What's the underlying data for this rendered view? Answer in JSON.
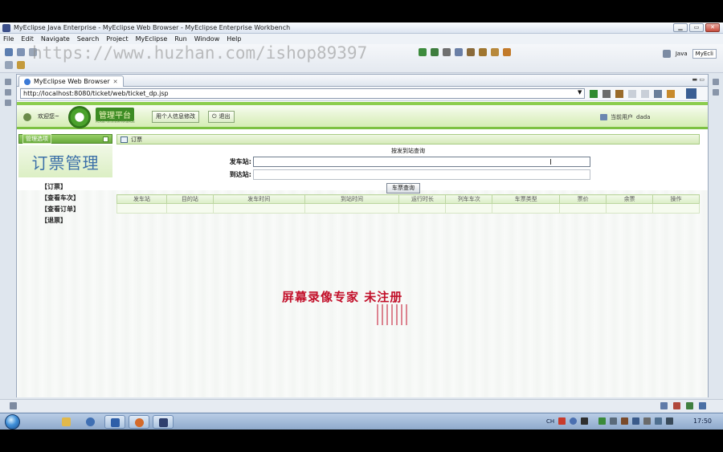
{
  "window": {
    "title": "MyEclipse Java Enterprise - MyEclipse Web Browser - MyEclipse Enterprise Workbench",
    "minimize": "▁",
    "maximize": "▭",
    "close": "✕"
  },
  "menubar": [
    "File",
    "Edit",
    "Navigate",
    "Search",
    "Project",
    "MyEclipse",
    "Run",
    "Window",
    "Help"
  ],
  "toolbar": {
    "watermark": "https://www.huzhan.com/ishop89397",
    "perspectives": [
      "Java",
      "MyEcli"
    ]
  },
  "editor": {
    "tab_label": "MyEclipse Web Browser",
    "tab_close": "✕",
    "controls": "▬ ▭",
    "url": "http://localhost:8080/ticket/web/ticket_dp.jsp"
  },
  "site_header": {
    "welcome": "欢迎您~",
    "logo_title": "管理平台",
    "logo_sub": "PLANT·SYSTEM·MANAGE",
    "edit_profile_button": "用个人信息修改",
    "logout_button": "退出",
    "current_user_label": "当前用户",
    "current_user": "dada"
  },
  "sidebar": {
    "options_label": "管理选项",
    "heading": "订票管理",
    "links": [
      "【订票】",
      "【查看车次】",
      "【查看订单】",
      "【退票】"
    ]
  },
  "main": {
    "section_title": "订票",
    "query_heading": "按发到站查询",
    "from_label": "发车站:",
    "to_label": "到达站:",
    "query_button": "车票查询",
    "columns": [
      "发车站",
      "目的站",
      "发车时间",
      "到站时间",
      "运行时长",
      "列车车次",
      "车票类型",
      "票价",
      "余票",
      "操作"
    ]
  },
  "recorder_watermark": "屏幕录像专家  未注册",
  "taskbar": {
    "tray_lang": "CH",
    "clock": "17:50"
  }
}
